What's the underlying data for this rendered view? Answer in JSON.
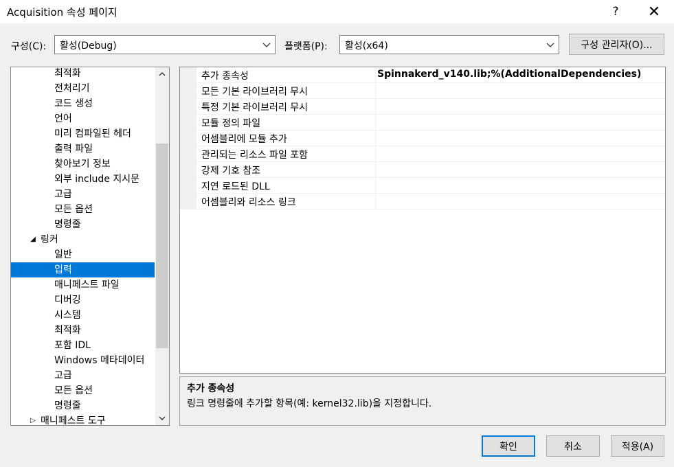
{
  "window": {
    "title": "Acquisition 속성 페이지",
    "help": "?",
    "close": "✕"
  },
  "config": {
    "config_label": "구성(C):",
    "config_value": "활성(Debug)",
    "platform_label": "플랫폼(P):",
    "platform_value": "활성(x64)",
    "manager_button": "구성 관리자(O)..."
  },
  "tree": {
    "items": [
      {
        "label": "최적화"
      },
      {
        "label": "전처리기"
      },
      {
        "label": "코드 생성"
      },
      {
        "label": "언어"
      },
      {
        "label": "미리 컴파일된 헤더"
      },
      {
        "label": "출력 파일"
      },
      {
        "label": "찾아보기 정보"
      },
      {
        "label": "외부 include 지시문"
      },
      {
        "label": "고급"
      },
      {
        "label": "모든 옵션"
      },
      {
        "label": "명령줄"
      },
      {
        "label": "링커",
        "expander": "◢"
      },
      {
        "label": "일반"
      },
      {
        "label": "입력",
        "selected": true
      },
      {
        "label": "매니페스트 파일"
      },
      {
        "label": "디버깅"
      },
      {
        "label": "시스템"
      },
      {
        "label": "최적화"
      },
      {
        "label": "포함 IDL"
      },
      {
        "label": "Windows 메타데이터"
      },
      {
        "label": "고급"
      },
      {
        "label": "모든 옵션"
      },
      {
        "label": "명령줄"
      },
      {
        "label": "매니페스트 도구",
        "expander": "▷"
      }
    ]
  },
  "grid": {
    "rows": [
      {
        "name": "추가 종속성",
        "value": "Spinnakerd_v140.lib;%(AdditionalDependencies)"
      },
      {
        "name": "모든 기본 라이브러리 무시",
        "value": ""
      },
      {
        "name": "특정 기본 라이브러리 무시",
        "value": ""
      },
      {
        "name": "모듈 정의 파일",
        "value": ""
      },
      {
        "name": "어셈블리에 모듈 추가",
        "value": ""
      },
      {
        "name": "관리되는 리소스 파일 포함",
        "value": ""
      },
      {
        "name": "강제 기호 참조",
        "value": ""
      },
      {
        "name": "지연 로드된 DLL",
        "value": ""
      },
      {
        "name": "어셈블리와 리소스 링크",
        "value": ""
      }
    ]
  },
  "description": {
    "title": "추가 종속성",
    "text": "링크 명령줄에 추가할 항목(예: kernel32.lib)을 지정합니다."
  },
  "buttons": {
    "ok": "확인",
    "cancel": "취소",
    "apply": "적용(A)"
  },
  "colors": {
    "selection": "#0078d7",
    "background": "#f0f0f0"
  }
}
